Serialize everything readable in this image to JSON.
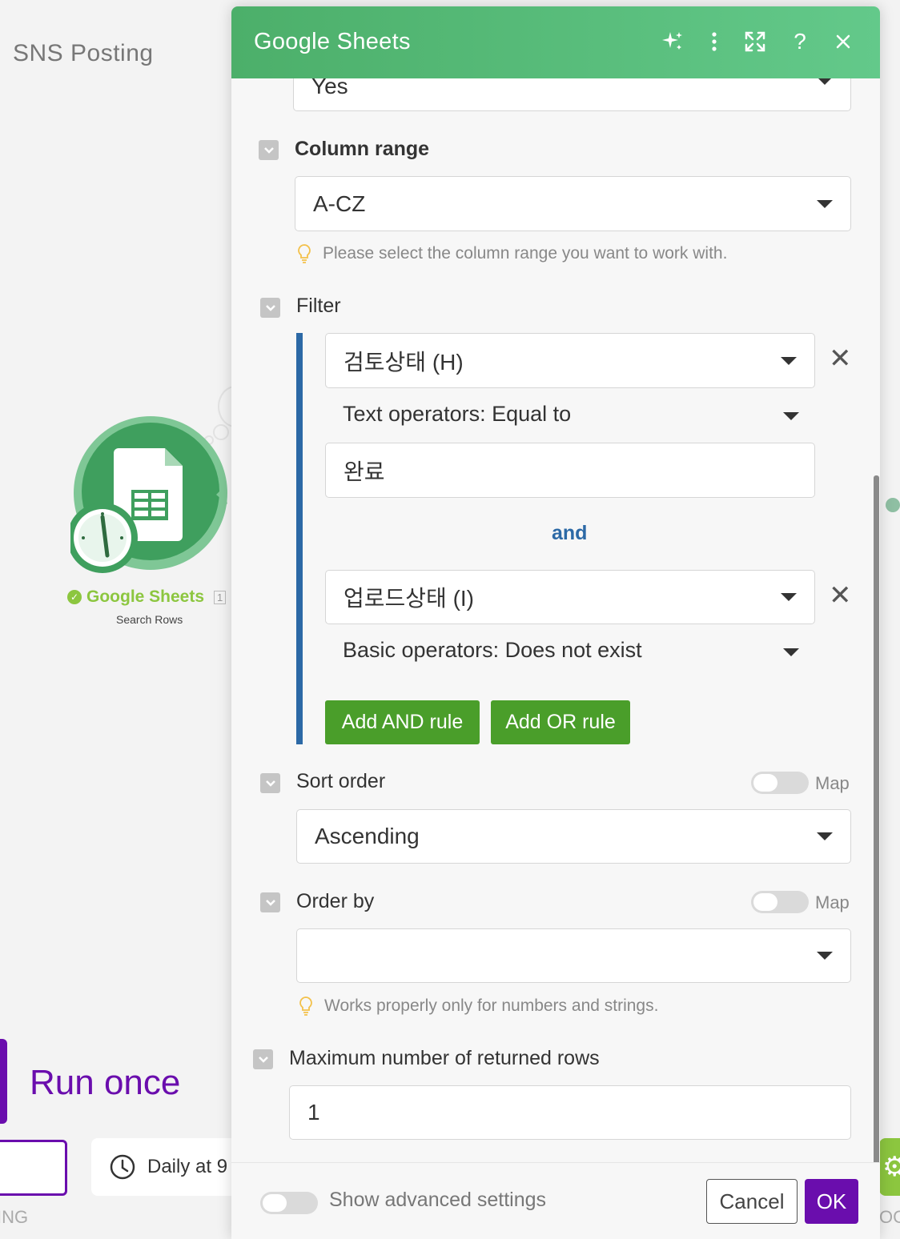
{
  "canvas": {
    "scenario_title": "SNS Posting",
    "module": {
      "name": "Google Sheets",
      "number": "1",
      "subtitle": "Search Rows",
      "color": "#8cc63f"
    },
    "run_once_label": "Run once",
    "schedule_label": "Daily at 9",
    "left_cut_label": "ING",
    "right_cut_label": "OC"
  },
  "dialog": {
    "title": "Google Sheets",
    "header_color": "#5bbf7f",
    "header_icons": [
      "sparkle-icon",
      "more-vertical-icon",
      "expand-icon",
      "help-icon",
      "close-icon"
    ],
    "top_select_value": "Yes",
    "column_range": {
      "label": "Column range",
      "value": "A-CZ",
      "hint": "Please select the column range you want to work with."
    },
    "filter": {
      "label": "Filter",
      "rules": [
        {
          "column": "검토상태 (H)",
          "operator": "Text operators: Equal to",
          "value": "완료"
        },
        {
          "column": "업로드상태 (I)",
          "operator": "Basic operators: Does not exist",
          "value": ""
        }
      ],
      "and_label": "and",
      "add_and_label": "Add AND rule",
      "add_or_label": "Add OR rule"
    },
    "sort_order": {
      "label": "Sort order",
      "map_label": "Map",
      "value": "Ascending"
    },
    "order_by": {
      "label": "Order by",
      "map_label": "Map",
      "value": "",
      "hint": "Works properly only for numbers and strings."
    },
    "max_rows": {
      "label": "Maximum number of returned rows",
      "value": "1"
    },
    "footer": {
      "advanced_label": "Show advanced settings",
      "cancel_label": "Cancel",
      "ok_label": "OK",
      "ok_color": "#6a0dad"
    }
  }
}
